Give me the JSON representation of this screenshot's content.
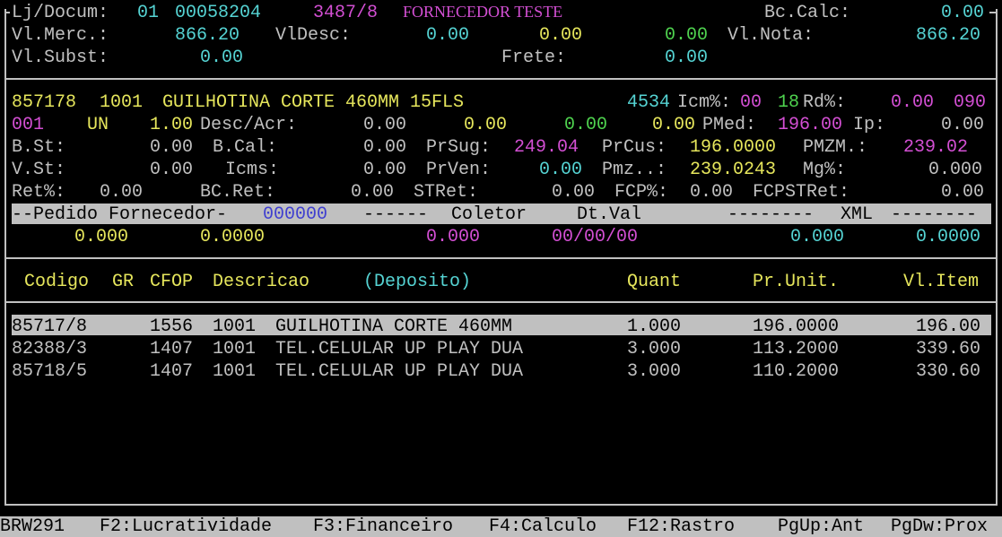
{
  "header": {
    "lj_label": "Lj/Docum:",
    "lj_store": "01",
    "doc_number": "00058204",
    "supplier_code": "3487/8",
    "supplier_name": "FORNECEDOR TESTE",
    "bc_calc_label": "Bc.Calc:",
    "bc_calc_value": "0.00",
    "vl_merc_label": "Vl.Merc.:",
    "vl_merc_value": "866.20",
    "vl_desc_label": "VlDesc:",
    "vl_desc_value1": "0.00",
    "vl_desc_value2": "0.00",
    "vl_desc_value3": "0.00",
    "vl_nota_label": "Vl.Nota:",
    "vl_nota_value": "866.20",
    "vl_subst_label": "Vl.Subst:",
    "vl_subst_value": "0.00",
    "frete_label": "Frete:",
    "frete_value": "0.00"
  },
  "item": {
    "code": "857178",
    "cfop": "1001",
    "description": "GUILHOTINA CORTE 460MM 15FLS",
    "ncm_code": "4534",
    "icm_label": "Icm%:",
    "icm_value": "00",
    "icm_rate": "18",
    "rd_label": "Rd%:",
    "rd_value": "0.00",
    "rd_code": "090",
    "seq": "001",
    "unit": "UN",
    "qty": "1.00",
    "desc_acr_label": "Desc/Acr:",
    "desc_acr_value1": "0.00",
    "desc_acr_value2": "0.00",
    "desc_acr_value3": "0.00",
    "desc_acr_value4": "0.00",
    "pmed_label": "PMed:",
    "pmed_value": "196.00",
    "ip_label": "Ip:",
    "ip_value": "0.00",
    "bst_label": "B.St:",
    "bst_value": "0.00",
    "bcal_label": "B.Cal:",
    "bcal_value": "0.00",
    "prsug_label": "PrSug:",
    "prsug_value": "249.04",
    "prcus_label": "PrCus:",
    "prcus_value": "196.0000",
    "pmzm_label": "PMZM.:",
    "pmzm_value": "239.02",
    "vst_label": "V.St:",
    "vst_value": "0.00",
    "icms_label": "Icms:",
    "icms_value": "0.00",
    "prven_label": "PrVen:",
    "prven_value": "0.00",
    "pmz_label": "Pmz..:",
    "pmz_value": "239.0243",
    "mg_label": "Mg%:",
    "mg_value": "0.000",
    "ret_label": "Ret%:",
    "ret_value": "0.00",
    "bcret_label": "BC.Ret:",
    "bcret_value": "0.00",
    "stret_label": "STRet:",
    "stret_value": "0.00",
    "fcp_label": "FCP%:",
    "fcp_value": "0.00",
    "fcpstret_label": "FCPSTRet:",
    "fcpstret_value": "0.00"
  },
  "bar": {
    "pedido_label": "--Pedido Fornecedor-",
    "pedido_value": "000000",
    "dashes1": "------",
    "coletor_label": "Coletor",
    "dtval_label": "Dt.Val",
    "dashes2": "--------",
    "xml_label": "XML",
    "dashes3": "--------",
    "v1": "0.000",
    "v2": "0.0000",
    "v3": "0.000",
    "v4": "00/00/00",
    "v5": "0.000",
    "v6": "0.0000"
  },
  "table": {
    "headers": {
      "codigo": "Codigo",
      "gr": "GR",
      "cfop": "CFOP",
      "descricao": "Descricao",
      "deposito": "(Deposito)",
      "quant": "Quant",
      "prunit": "Pr.Unit.",
      "vlitem": "Vl.Item"
    },
    "rows": [
      {
        "codigo": "85717/8",
        "gr": "1556",
        "cfop": "1001",
        "descricao": "GUILHOTINA CORTE 460MM",
        "quant": "1.000",
        "prunit": "196.0000",
        "vlitem": "196.00"
      },
      {
        "codigo": "82388/3",
        "gr": "1407",
        "cfop": "1001",
        "descricao": "TEL.CELULAR UP PLAY DUA",
        "quant": "3.000",
        "prunit": "113.2000",
        "vlitem": "339.60"
      },
      {
        "codigo": "85718/5",
        "gr": "1407",
        "cfop": "1001",
        "descricao": "TEL.CELULAR UP PLAY DUA",
        "quant": "3.000",
        "prunit": "110.2000",
        "vlitem": "330.60"
      }
    ]
  },
  "status_bar": {
    "program": "BRW291",
    "f2": "F2:Lucratividade",
    "f3": "F3:Financeiro",
    "f4": "F4:Calculo",
    "f12": "F12:Rastro",
    "pgup": "PgUp:Ant",
    "pgdw": "PgDw:Prox"
  }
}
